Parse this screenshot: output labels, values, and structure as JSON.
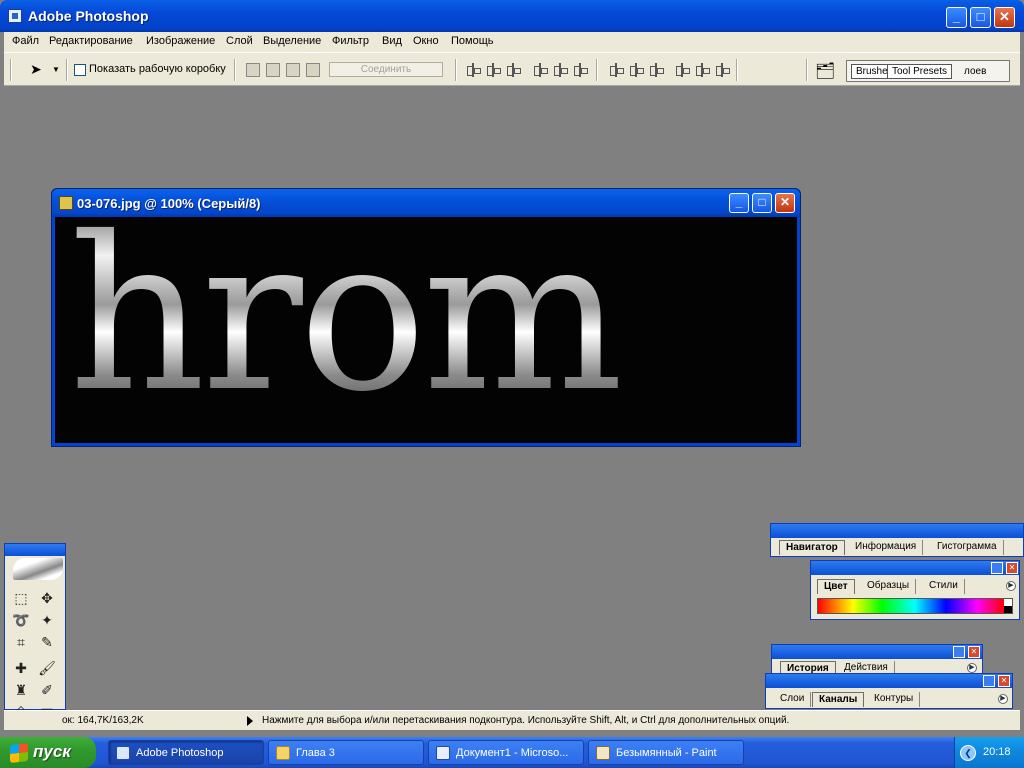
{
  "app": {
    "title": "Adobe Photoshop"
  },
  "window_controls": {
    "minimize": "_",
    "maximize": "□",
    "close": "✕"
  },
  "menu": [
    "Файл",
    "Редактирование",
    "Изображение",
    "Слой",
    "Выделение",
    "Фильтр",
    "Вид",
    "Окно",
    "Помощь"
  ],
  "options_bar": {
    "show_bounding_box_label": "Показать рабочую коробку",
    "merge_button": "Соединить",
    "palette_well_tabs": [
      "Brushe",
      "Tool Presets",
      "лоев"
    ]
  },
  "document": {
    "title": "03-076.jpg @ 100% (Серый/8)",
    "canvas_text": "hrom"
  },
  "palettes": {
    "navigator_tabs": [
      "Навигатор",
      "Информация",
      "Гистограмма"
    ],
    "color_tabs": [
      "Цвет",
      "Образцы",
      "Стили"
    ],
    "history_tabs": [
      "История",
      "Действия"
    ],
    "layers_tabs": [
      "Слои",
      "Каналы",
      "Контуры"
    ]
  },
  "status": {
    "doc_size": "ок: 164,7K/163,2K",
    "hint": "Нажмите для выбора и/или перетаскивания подконтура.  Используйте Shift, Alt, и Ctrl для дополнительных опций."
  },
  "taskbar": {
    "start_label": "пуск",
    "tasks": [
      "Adobe Photoshop",
      "Глава 3",
      "Документ1 - Microso...",
      "Безымянный - Paint"
    ],
    "clock": "20:18"
  },
  "icons": {
    "app": "photoshop-icon",
    "document": "jpg-document-icon"
  },
  "colors": {
    "xp_blue": "#0548d8",
    "start_green": "#319a2d",
    "workspace_gray": "#808080"
  }
}
